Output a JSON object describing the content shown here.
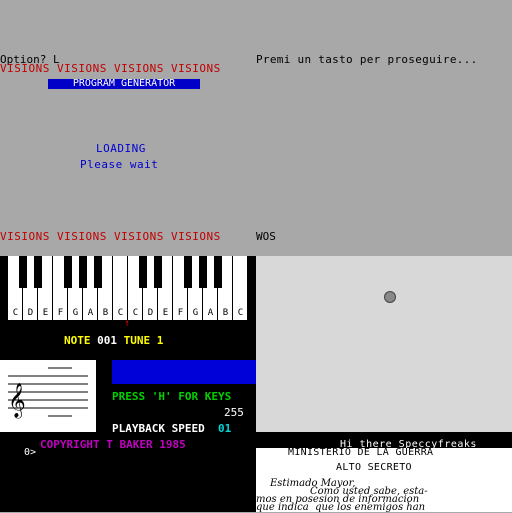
{
  "top": {
    "option_prompt": "Option? L",
    "premi": "Premi un tasto per proseguire...",
    "visions_top": "VISIONS VISIONS VISIONS VISIONS",
    "program_generator": "PROGRAM GENERATOR",
    "loading": "LOADING",
    "please_wait": "Please wait",
    "visions_bottom": "VISIONS VISIONS VISIONS VISIONS",
    "wos": "WOS"
  },
  "piano": {
    "keys": [
      "C",
      "D",
      "E",
      "F",
      "G",
      "A",
      "B",
      "C",
      "C",
      "D",
      "E",
      "F",
      "G",
      "A",
      "B",
      "C"
    ],
    "marker": "↑",
    "note_label": "NOTE",
    "note_value": "001",
    "tune_label": "TUNE",
    "tune_value": "1",
    "press_h": "PRESS 'H' FOR KEYS",
    "number": "255",
    "playback_label": "PLAYBACK SPEED",
    "playback_value": "01"
  },
  "bottom_left": {
    "copyright": "COPYRIGHT T BAKER 1985",
    "prompt": "0>"
  },
  "letter": {
    "hi": "Hi there Speccyfreaks",
    "ministerio": "MINISTERIO DE LA GUERRA",
    "alto": "ALTO SECRETO",
    "line1": "Estimado Mayor,",
    "line2": "Como usted sabe, esta-",
    "line3": "mos en posesion de informacion",
    "line4": "que indica  que los enemigos han"
  },
  "colors": {
    "grey_bg": "#a8a8a8",
    "red_text": "#c00000",
    "blue_banner": "#0000c8",
    "yellow": "#ffff00",
    "green": "#00d000",
    "magenta": "#c000c0",
    "cyan": "#00d8d8"
  }
}
